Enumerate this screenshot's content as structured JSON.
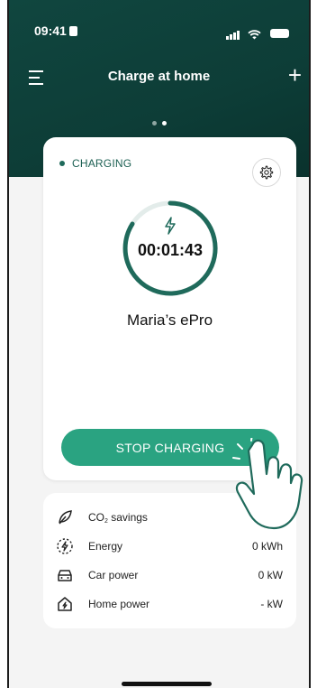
{
  "status_bar": {
    "time": "09:41"
  },
  "nav": {
    "title": "Charge at home"
  },
  "charger": {
    "state": "CHARGING",
    "elapsed": "00:01:43",
    "name": "Maria’s ePro",
    "stop_label": "STOP CHARGING"
  },
  "stats": {
    "co2": {
      "label_main": "CO",
      "label_sub": "2",
      "label_rest": " savings",
      "value": ""
    },
    "energy": {
      "label": "Energy",
      "value": "0 kWh"
    },
    "car_power": {
      "label": "Car power",
      "value": "0 kW"
    },
    "home_power": {
      "label": "Home power",
      "value": "- kW"
    }
  },
  "colors": {
    "header": "#10463f",
    "accent": "#2aa381",
    "ring": "#1f6a5b"
  }
}
